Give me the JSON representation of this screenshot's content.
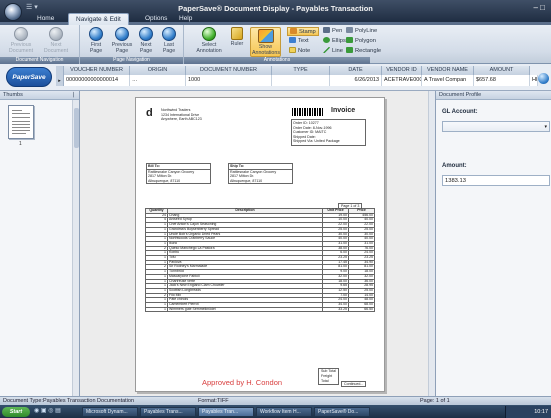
{
  "window": {
    "title": "PaperSave® Document Display - Payables Transaction",
    "quick_access": "☰ ▾",
    "controls": "–  □"
  },
  "ribbon": {
    "tabs": [
      "Home",
      "Navigate & Edit",
      "Options",
      "Help"
    ],
    "groups": {
      "document_navigation": {
        "label": "Document Navigation",
        "buttons": [
          "Previous Document",
          "Next Document"
        ]
      },
      "page_navigation": {
        "label": "Page Navigation",
        "buttons": [
          "First Page",
          "Previous Page",
          "Next Page",
          "Last Page"
        ]
      },
      "annotations": {
        "label": "Annotations",
        "buttons": [
          "Select Annotation",
          "Ruler",
          "Show Annotations"
        ],
        "tools": [
          "Stamp",
          "Pen",
          "PolyLine",
          "Text",
          "Ellipse",
          "Polygon",
          "Note",
          "Line",
          "Rectangle"
        ]
      }
    }
  },
  "index_grid": {
    "logo": "PaperSave",
    "headers": [
      "VOUCHER NUMBER",
      "ORIGIN",
      "DOCUMENT NUMBER",
      "TYPE",
      "DATE",
      "VENDOR ID",
      "VENDOR NAME",
      "AMOUNT"
    ],
    "row": [
      "00000000000000014",
      "…",
      "1000",
      "",
      "6/26/2013",
      "ACETRAVE0001",
      "A Travel Compan",
      "$657.68"
    ],
    "extra": "HI"
  },
  "thumbnails": {
    "title": "Thumbs",
    "pin": "❘",
    "page_number": "1"
  },
  "invoice": {
    "company_lines": [
      "Northwind Traders",
      "1234 International Drive",
      "Anywhere, Earth  ABC123"
    ],
    "title": "Invoice",
    "meta": [
      "Order ID:   10277",
      "Order Date:  8-Nov-1996",
      "Customer ID:  MAITC",
      "Shipped Date:",
      "Shipped Via:  United Package"
    ],
    "bill_to": {
      "label": "Bill To:",
      "lines": [
        "Rattlesnake Canyon Grocery",
        "2817 Milton Dr.",
        "Albuquerque, 87110"
      ]
    },
    "ship_to": {
      "label": "Ship To:",
      "lines": [
        "Rattlesnake Canyon Grocery",
        "2817 Milton Dr.",
        "Albuquerque, 87110"
      ]
    },
    "page_of": "Page 1 of 3",
    "columns": [
      "Quantity",
      "Description",
      "Unit Price",
      "Price"
    ],
    "items": [
      [
        "24",
        "Chang",
        "19.00",
        "456.00"
      ],
      [
        "4",
        "Aniseed Syrup",
        "10.00",
        "40.00"
      ],
      [
        "1",
        "Chef Anton's Cajun Seasoning",
        "22.00",
        "22.00"
      ],
      [
        "1",
        "Grandma's Boysenberry Spread",
        "25.00",
        "25.00"
      ],
      [
        "1",
        "Uncle Bob's Organic Dried Pears",
        "30.00",
        "30.00"
      ],
      [
        "1",
        "Northwoods Cranberry Sauce",
        "40.00",
        "40.00"
      ],
      [
        "1",
        "Ikura",
        "31.00",
        "31.00"
      ],
      [
        "2",
        "Queso Manchego La Pastora",
        "38.00",
        "76.00"
      ],
      [
        "1",
        "Konbu",
        "6.00",
        "24.00"
      ],
      [
        "1",
        "Tofu",
        "23.25",
        "23.25"
      ],
      [
        "1",
        "Pavlova",
        "17.45",
        "34.90"
      ],
      [
        "2",
        "Sir Rodney's Marmalade",
        "81.00",
        "81.00"
      ],
      [
        "1",
        "Tunnbröd",
        "9.00",
        "18.00"
      ],
      [
        "1",
        "Mascarpone Fabioli",
        "32.00",
        "32.00"
      ],
      [
        "1",
        "Chartreuse verte",
        "18.00",
        "36.00"
      ],
      [
        "1",
        "Jack's New England Clam Chowder",
        "9.65",
        "28.95"
      ],
      [
        "1",
        "Scottish Longbreads",
        "12.50",
        "25.00"
      ],
      [
        "2",
        "Filo Mix",
        "7.00",
        "14.00"
      ],
      [
        "1",
        "Pâté chinois",
        "24.00",
        "48.00"
      ],
      [
        "1",
        "Camembert Pierrot",
        "34.00",
        "68.00"
      ],
      [
        "1",
        "Wimmers gute Semmelknödel",
        "33.25",
        "66.50"
      ]
    ],
    "totals": [
      "Sub Total",
      "Freight",
      "Total"
    ],
    "continued": "Continued...",
    "approval": "Approved by H. Condon"
  },
  "profile": {
    "title": "Document Profile",
    "gl_label": "GL Account:",
    "gl_value": "",
    "amount_label": "Amount:",
    "amount_value": "1383.13"
  },
  "statusbar": {
    "doc_type": "Document Type:Payables Transaction Documentation",
    "format": "Format:TIFF",
    "page": "Page: 1 of 1"
  },
  "taskbar": {
    "start": "Start",
    "quick_icons": "◉ ▣ ◎ ▤",
    "tasks": [
      "Microsoft Dynam...",
      "Payables Trans...",
      "Payables Tran...",
      "Workflow Item H...",
      "PaperSave® Do..."
    ],
    "active_index": 2,
    "clock": "10:17"
  }
}
